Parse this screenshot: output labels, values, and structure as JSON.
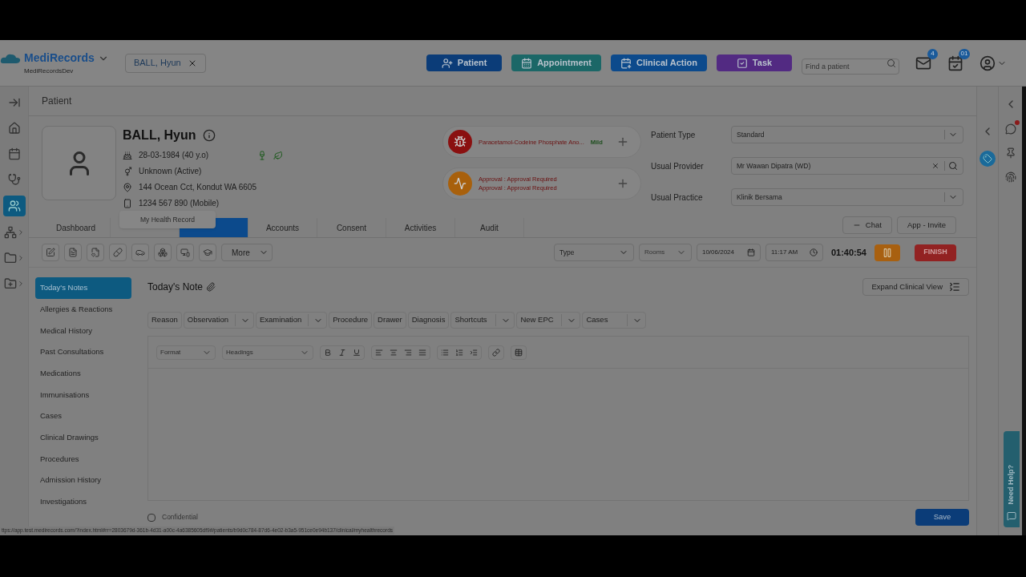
{
  "header": {
    "brand": "MediRecords",
    "org": "MediRecordsDev",
    "open_patient": "BALL, Hyun",
    "actions": [
      {
        "kind": "patient",
        "label": "Patient",
        "color": "#0b3c78"
      },
      {
        "kind": "appointment",
        "label": "Appointment",
        "color": "#1b6767"
      },
      {
        "kind": "clinical",
        "label": "Clinical Action",
        "color": "#0c4a8c"
      },
      {
        "kind": "task",
        "label": "Task",
        "color": "#522a82"
      }
    ],
    "search": {
      "placeholder": "Find a patient"
    },
    "mail_badge": "4",
    "calendar_badge": "01"
  },
  "page_title": "Patient",
  "patient": {
    "name": "BALL, Hyun",
    "details": [
      {
        "kind": "dob",
        "text": "28-03-1984 (40 y.o)"
      },
      {
        "kind": "gender",
        "text": "Unknown (Active)"
      },
      {
        "kind": "address",
        "text": "144 Ocean Cct, Kondut WA 6605"
      },
      {
        "kind": "phone",
        "text": "1234 567 890 (Mobile)"
      }
    ]
  },
  "alerts": [
    {
      "kind": "allergy",
      "lines": [
        "Paracetamol-Codeine Phosphate Ano..."
      ],
      "severity": "Mild"
    },
    {
      "kind": "approval",
      "lines": [
        "Approval : Approval Required",
        "Approval : Approval Required"
      ]
    }
  ],
  "fields": [
    {
      "kind": "select",
      "label": "Patient Type",
      "value": "Standard"
    },
    {
      "kind": "search",
      "label": "Usual Provider",
      "value": "Mr Wawan Dipatra (WD)"
    },
    {
      "kind": "select",
      "label": "Usual Practice",
      "value": "Klinik Bersama"
    }
  ],
  "chat_buttons": [
    "Chat",
    "App - Invite"
  ],
  "tabs": [
    {
      "label": "Dashboard",
      "selected": false
    },
    {
      "selected": false
    },
    {
      "selected": true
    },
    {
      "label": "Accounts",
      "selected": false
    },
    {
      "label": "Consent",
      "selected": false
    },
    {
      "label": "Activities",
      "selected": false
    },
    {
      "label": "Audit",
      "selected": false
    }
  ],
  "tooltip": "My Health Record",
  "toolbar": {
    "more": "More",
    "type": "Type",
    "rooms": "Rooms",
    "date": "10/06/2024",
    "time": "11:17 AM",
    "timer": "01:40:54",
    "finish": "FINISH"
  },
  "nav": [
    {
      "label": "Today's Notes",
      "selected": true
    },
    {
      "label": "Allergies & Reactions",
      "selected": false
    },
    {
      "label": "Medical History",
      "selected": false
    },
    {
      "label": "Past Consultations",
      "selected": false
    },
    {
      "label": "Medications",
      "selected": false
    },
    {
      "label": "Immunisations",
      "selected": false
    },
    {
      "label": "Cases",
      "selected": false
    },
    {
      "label": "Clinical Drawings",
      "selected": false
    },
    {
      "label": "Procedures",
      "selected": false
    },
    {
      "label": "Admission History",
      "selected": false
    },
    {
      "label": "Investigations",
      "selected": false
    }
  ],
  "note": {
    "title": "Today's Note",
    "expand": "Expand Clinical View",
    "sections": [
      {
        "label": "Reason",
        "dropdown": false
      },
      {
        "label": "Observation",
        "dropdown": true
      },
      {
        "label": "Examination",
        "dropdown": true
      },
      {
        "label": "Procedure",
        "dropdown": false
      },
      {
        "label": "Drawer",
        "dropdown": false
      },
      {
        "label": "Diagnosis",
        "dropdown": false
      },
      {
        "label": "Shortcuts",
        "dropdown": true
      },
      {
        "label": "New EPC",
        "dropdown": true
      },
      {
        "label": "Cases",
        "dropdown": true
      }
    ],
    "format": "Format",
    "headings": "Headings",
    "confidential": {
      "label": "Confidential",
      "checked": false
    },
    "save": "Save"
  },
  "status_url": "ttps://app.test.medirecords.com/?index.html#rr=2803679d-361b-4d31-a00c-4a6385605df9#/patients/b9d0c784-87d6-4e02-b3a5-951ce0e94b137/clinical/myhealthrecords",
  "help_tab": "Need Help?"
}
